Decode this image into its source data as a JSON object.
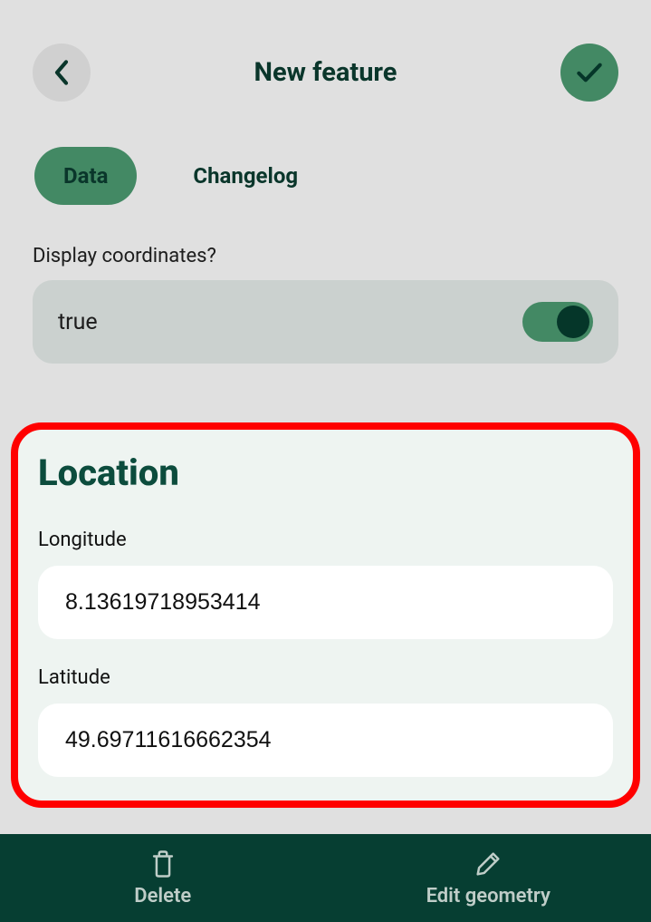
{
  "header": {
    "title": "New feature"
  },
  "tabs": {
    "data_label": "Data",
    "changelog_label": "Changelog"
  },
  "display_coords": {
    "label": "Display coordinates?",
    "value_text": "true"
  },
  "location": {
    "title": "Location",
    "longitude_label": "Longitude",
    "longitude_value": "8.13619718953414",
    "latitude_label": "Latitude",
    "latitude_value": "49.69711616662354"
  },
  "bottom": {
    "delete_label": "Delete",
    "edit_geometry_label": "Edit geometry"
  }
}
